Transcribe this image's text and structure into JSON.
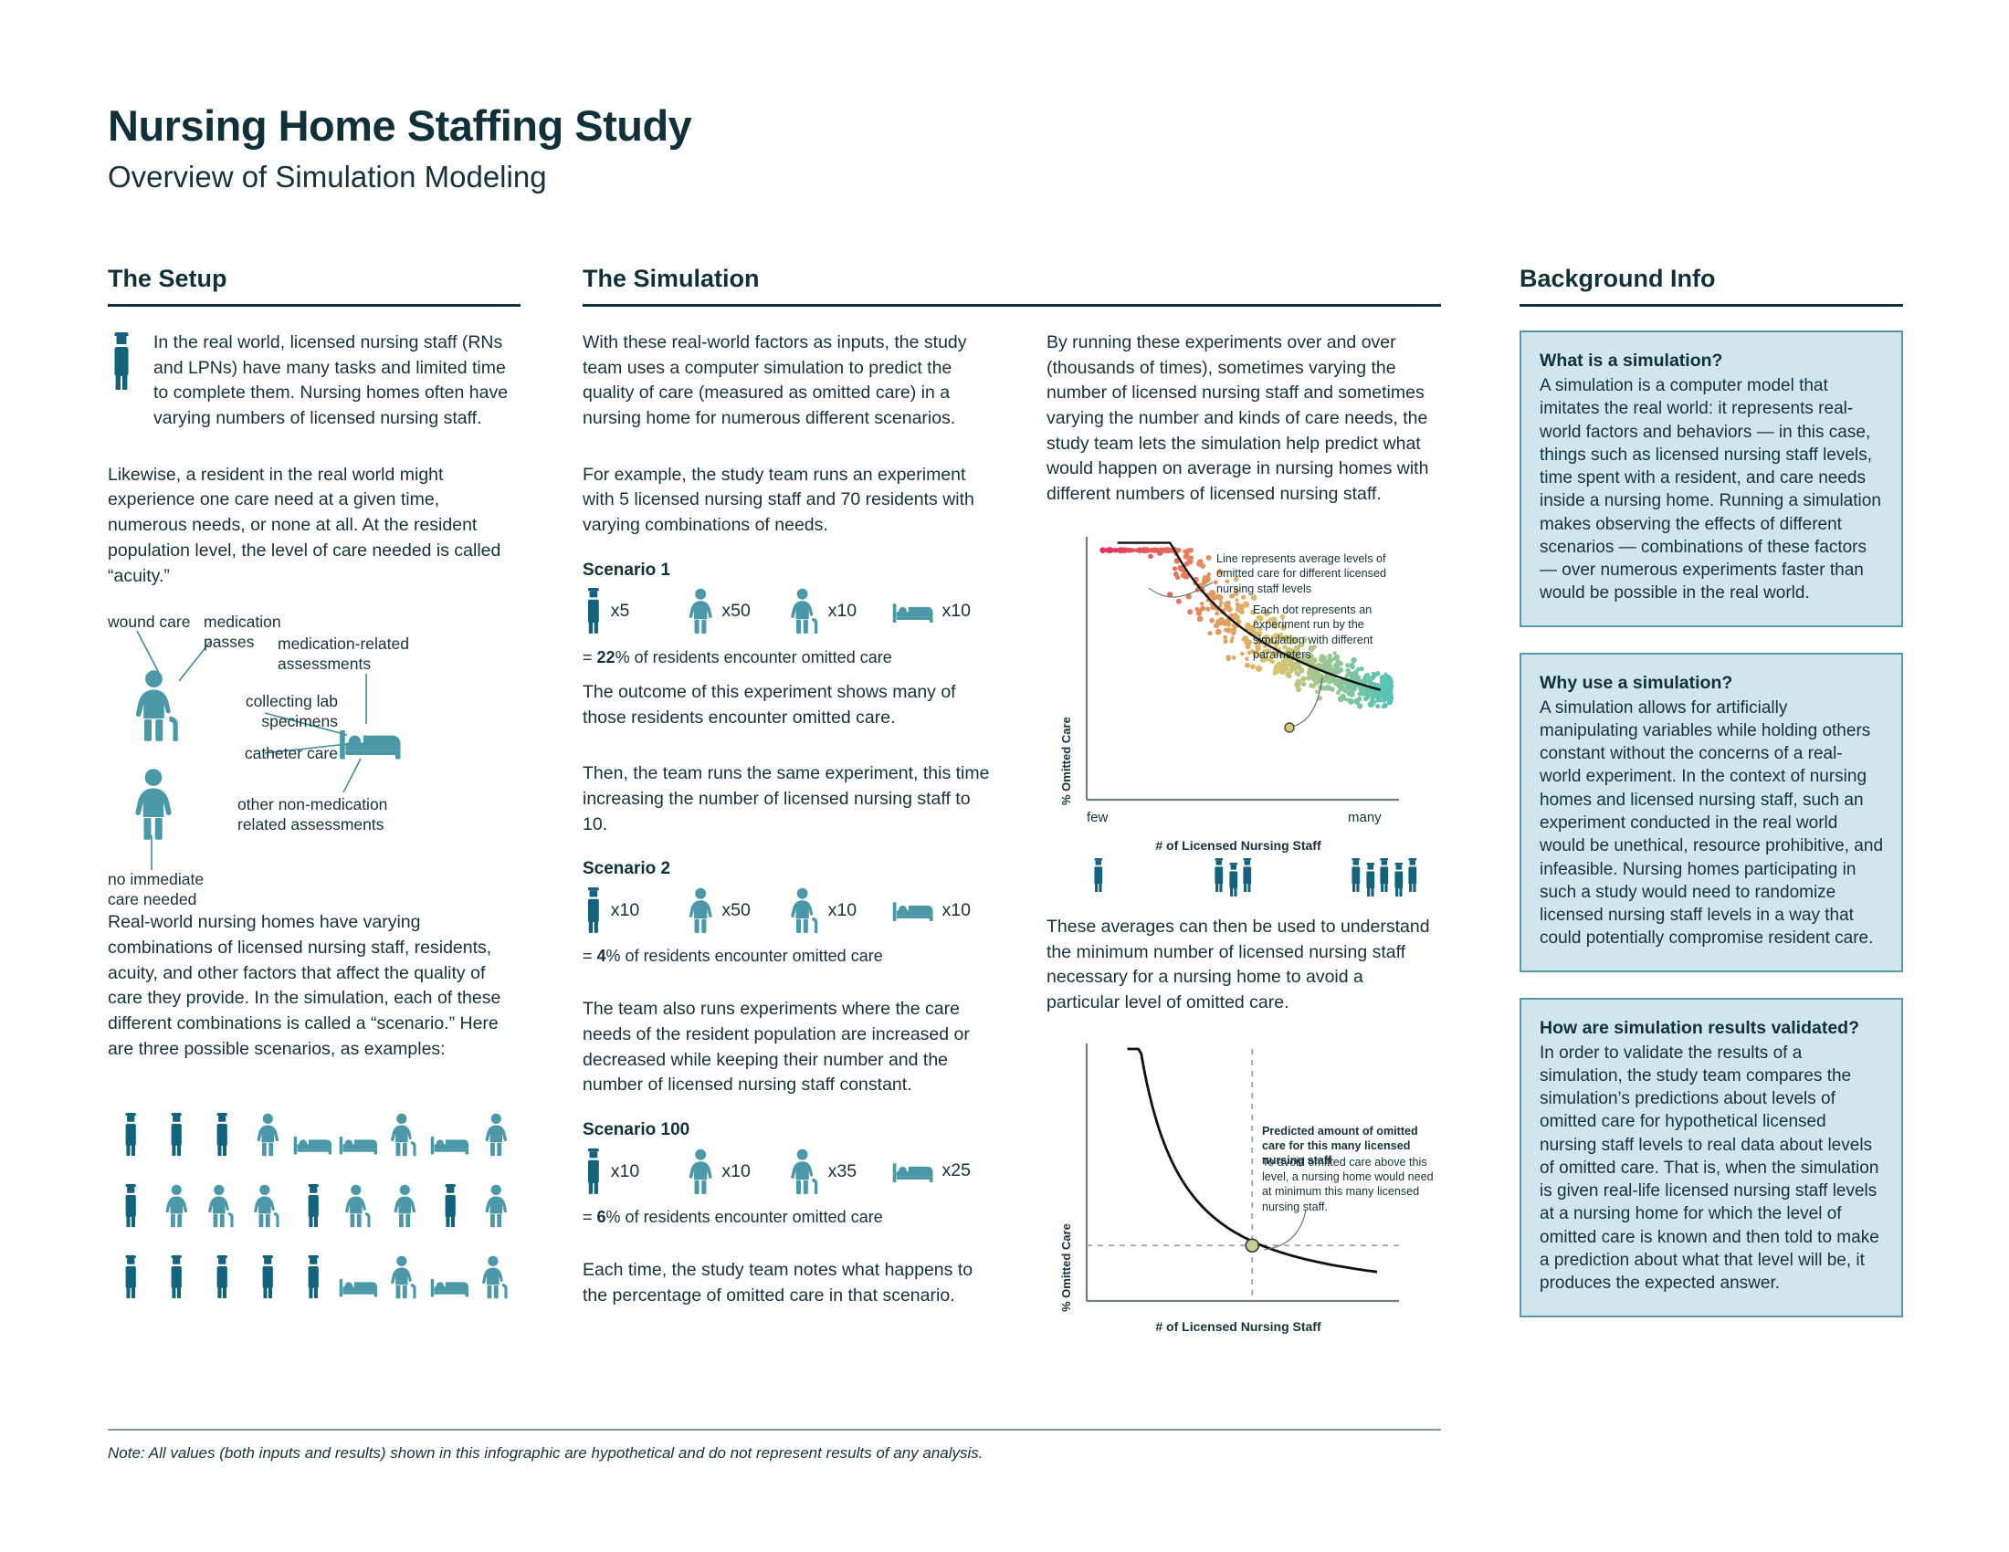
{
  "header": {
    "title": "Nursing Home Staffing Study",
    "subtitle": "Overview of Simulation Modeling"
  },
  "columns": {
    "setup_title": "The Setup",
    "simulation_title": "The Simulation",
    "background_title": "Background Info"
  },
  "setup": {
    "intro": "In the real world, licensed nursing staff (RNs and LPNs) have many tasks and limited time to complete them. Nursing homes often have varying numbers of licensed nursing staff.",
    "acuity": "Likewise, a resident in the real world might experience one care need at a given time, numerous needs, or none at all. At the resident population level, the level of care needed is called “acuity.”",
    "care_labels": {
      "wound_care": "wound care",
      "medication_passes": "medication passes",
      "medication_related_assessments": "medication-related assessments",
      "collecting_lab_specimens": "collecting lab specimens",
      "catheter_care": "catheter care",
      "other_assessments": "other non-medication related assessments",
      "no_care": "no immediate care needed"
    },
    "scenarios_intro": "Real-world nursing homes have varying combinations of licensed nursing staff, residents, acuity, and other factors that affect the quality of care they provide. In the simulation, each of these different combinations is called a “scenario.” Here are three possible scenarios, as examples:",
    "pictogram_rows": [
      [
        "nurse",
        "nurse",
        "nurse",
        "resident",
        "bed",
        "bed",
        "resident-cane",
        "bed",
        "resident"
      ],
      [
        "nurse",
        "resident",
        "resident-cane",
        "resident-cane",
        "nurse",
        "resident-cane",
        "resident",
        "nurse",
        "resident"
      ],
      [
        "nurse",
        "nurse",
        "nurse",
        "nurse",
        "nurse",
        "bed",
        "resident-cane",
        "bed",
        "resident-cane"
      ]
    ]
  },
  "simulation": {
    "intro": "With these real-world factors as inputs, the study team uses a computer simulation to predict the quality of care (measured as omitted care) in a nursing home for numerous different scenarios.",
    "example_intro": "For example, the study team runs an experiment with 5 licensed nursing staff and 70 residents with varying combinations of needs.",
    "outcome_1": "The outcome of this experiment shows many of those residents encounter omitted care.",
    "scenario2_intro": "Then, the team runs the same experiment, this time increasing the number of licensed nursing staff to 10.",
    "scenario100_intro": "The team also runs experiments where the care needs of the resident population are increased or decreased while keeping their number and the number of licensed nursing staff constant.",
    "closing": "Each time, the study team notes what happens to the percentage of omitted care in that scenario.",
    "result_prefix": "=",
    "result_suffix": "% of residents encounter omitted care",
    "scenarios": [
      {
        "label": "Scenario 1",
        "items": [
          {
            "icon": "nurse",
            "count": "x5"
          },
          {
            "icon": "resident",
            "count": "x50"
          },
          {
            "icon": "resident-cane",
            "count": "x10"
          },
          {
            "icon": "bed",
            "count": "x10"
          }
        ],
        "result_value": "22"
      },
      {
        "label": "Scenario 2",
        "items": [
          {
            "icon": "nurse",
            "count": "x10"
          },
          {
            "icon": "resident",
            "count": "x50"
          },
          {
            "icon": "resident-cane",
            "count": "x10"
          },
          {
            "icon": "bed",
            "count": "x10"
          }
        ],
        "result_value": "4"
      },
      {
        "label": "Scenario 100",
        "items": [
          {
            "icon": "nurse",
            "count": "x10"
          },
          {
            "icon": "resident",
            "count": "x10"
          },
          {
            "icon": "resident-cane",
            "count": "x35"
          },
          {
            "icon": "bed",
            "count": "x25"
          }
        ],
        "result_value": "6"
      }
    ],
    "right_intro": "By running these experiments over and over (thousands of times), sometimes varying the number of licensed nursing staff and sometimes varying the number and kinds of care needs, the study team lets the simulation help predict what would happen on average in nursing homes with different numbers of licensed nursing staff.",
    "right_mid": "These averages can then be used to understand the minimum number of licensed nursing staff necessary for a nursing home to avoid a particular level of omitted care."
  },
  "background": {
    "cards": [
      {
        "heading": "What is a simulation?",
        "body": "A simulation is a computer model that imitates the real world: it represents real-world factors and behaviors — in this case, things such as licensed nursing staff levels, time spent with a resident, and care needs inside a nursing home. Running a simulation makes observing the effects of different scenarios — combinations of these factors — over numerous experiments faster than would be possible in the real world."
      },
      {
        "heading": "Why use a simulation?",
        "body": "A simulation allows for artificially manipulating variables while holding others constant without the concerns of a real-world experiment. In the context of nursing homes and licensed nursing staff, such an experiment conducted in the real world would be unethical, resource prohibitive, and infeasible. Nursing homes participating in such a study would need to randomize licensed nursing staff levels in a way that could potentially compromise resident care."
      },
      {
        "heading": "How are simulation results validated?",
        "body": "In order to validate the results of a simulation, the study team compares the simulation’s predictions about levels of omitted care for hypothetical licensed nursing staff levels to real data about levels of omitted care. That is, when the simulation is given real-life licensed nursing staff levels at a nursing home for which the level of omitted care is known and then told to make a prediction about what that level will be, it produces the expected answer."
      }
    ]
  },
  "footer": {
    "note": "Note: All values (both inputs and results) shown in this infographic are hypothetical and do not represent results of any analysis."
  },
  "colors": {
    "nurse_dark": "#14637d",
    "resident_teal": "#4b99a8",
    "ink": "#16323c",
    "card_bg": "#cfe7ec",
    "card_border": "#5898a8",
    "axis_gray": "#6e8086",
    "scatter_high": "#e8305e",
    "scatter_low": "#5bc3b6"
  },
  "chart_data": [
    {
      "type": "scatter",
      "name": "omitted-care-scatter",
      "title": "",
      "xlabel": "# of Licensed Nursing Staff",
      "ylabel": "% Omitted Care",
      "x_tick_labels": [
        "few",
        "many"
      ],
      "grid": false,
      "legend": null,
      "annotations": [
        "Line represents average levels of omitted care for different licensed nursing staff levels",
        "Each dot represents an experiment run by the simulation with different parameters"
      ],
      "trend": {
        "type": "power-decay",
        "description": "average omitted care declines steeply then flattens as staff increases"
      },
      "staff_pictogram_groups": [
        1,
        3,
        5
      ],
      "series": [
        {
          "name": "simulation experiment runs",
          "color_low_x": "#e8305e",
          "color_high_x": "#5bc3b6",
          "n_points": 620,
          "x": [
            0.02,
            0.03,
            0.035,
            0.04,
            0.045,
            0.05,
            0.055,
            0.06,
            0.065,
            0.07,
            0.075,
            0.08,
            0.085,
            0.09,
            0.095,
            0.1,
            0.105,
            0.11,
            0.115,
            0.12,
            0.125,
            0.13,
            0.135,
            0.14,
            0.145,
            0.15,
            0.16,
            0.17,
            0.18,
            0.19,
            0.2,
            0.21,
            0.22,
            0.23,
            0.24,
            0.25,
            0.26,
            0.27,
            0.28,
            0.29,
            0.3,
            0.32,
            0.34,
            0.36,
            0.38,
            0.4,
            0.42,
            0.44,
            0.46,
            0.48,
            0.5,
            0.52,
            0.54,
            0.56,
            0.58,
            0.6,
            0.62,
            0.64,
            0.66,
            0.68,
            0.7,
            0.72,
            0.74,
            0.76,
            0.78,
            0.8,
            0.82,
            0.84,
            0.86,
            0.88,
            0.9,
            0.92,
            0.94,
            0.96,
            0.98
          ],
          "y": [
            0.95,
            0.93,
            0.97,
            0.91,
            0.88,
            0.94,
            0.9,
            0.86,
            0.92,
            0.83,
            0.87,
            0.8,
            0.85,
            0.78,
            0.82,
            0.76,
            0.8,
            0.72,
            0.77,
            0.7,
            0.74,
            0.68,
            0.72,
            0.65,
            0.69,
            0.63,
            0.6,
            0.58,
            0.62,
            0.55,
            0.57,
            0.52,
            0.54,
            0.5,
            0.52,
            0.48,
            0.5,
            0.46,
            0.48,
            0.44,
            0.45,
            0.42,
            0.43,
            0.4,
            0.41,
            0.38,
            0.36,
            0.37,
            0.34,
            0.33,
            0.32,
            0.3,
            0.31,
            0.28,
            0.29,
            0.26,
            0.27,
            0.24,
            0.25,
            0.23,
            0.22,
            0.21,
            0.22,
            0.2,
            0.19,
            0.2,
            0.18,
            0.17,
            0.18,
            0.16,
            0.17,
            0.15,
            0.16,
            0.14,
            0.15
          ]
        }
      ]
    },
    {
      "type": "line",
      "name": "minimum-staff-threshold",
      "title": "",
      "xlabel": "# of Licensed Nursing Staff",
      "ylabel": "% Omitted Care",
      "grid": false,
      "x_tick_labels": [],
      "annotations": [
        "Predicted amount of omitted care for this many licensed nursing staff",
        "To avoid omitted care above this level, a nursing home would need at minimum this many licensed nursing staff."
      ],
      "marker_point": {
        "x": 0.53,
        "y": 0.22,
        "color": "#c3d08b"
      },
      "reference_lines": {
        "vertical_x": 0.53,
        "horizontal_y": 0.22,
        "style": "dashed"
      },
      "series": [
        {
          "name": "average omitted care",
          "x": [
            0.13,
            0.18,
            0.23,
            0.28,
            0.33,
            0.38,
            0.43,
            0.48,
            0.53,
            0.58,
            0.63,
            0.68,
            0.73,
            0.78,
            0.83,
            0.88,
            0.93
          ],
          "y": [
            0.93,
            0.74,
            0.6,
            0.5,
            0.42,
            0.35,
            0.3,
            0.26,
            0.22,
            0.19,
            0.17,
            0.15,
            0.135,
            0.12,
            0.11,
            0.1,
            0.095
          ]
        }
      ]
    }
  ]
}
